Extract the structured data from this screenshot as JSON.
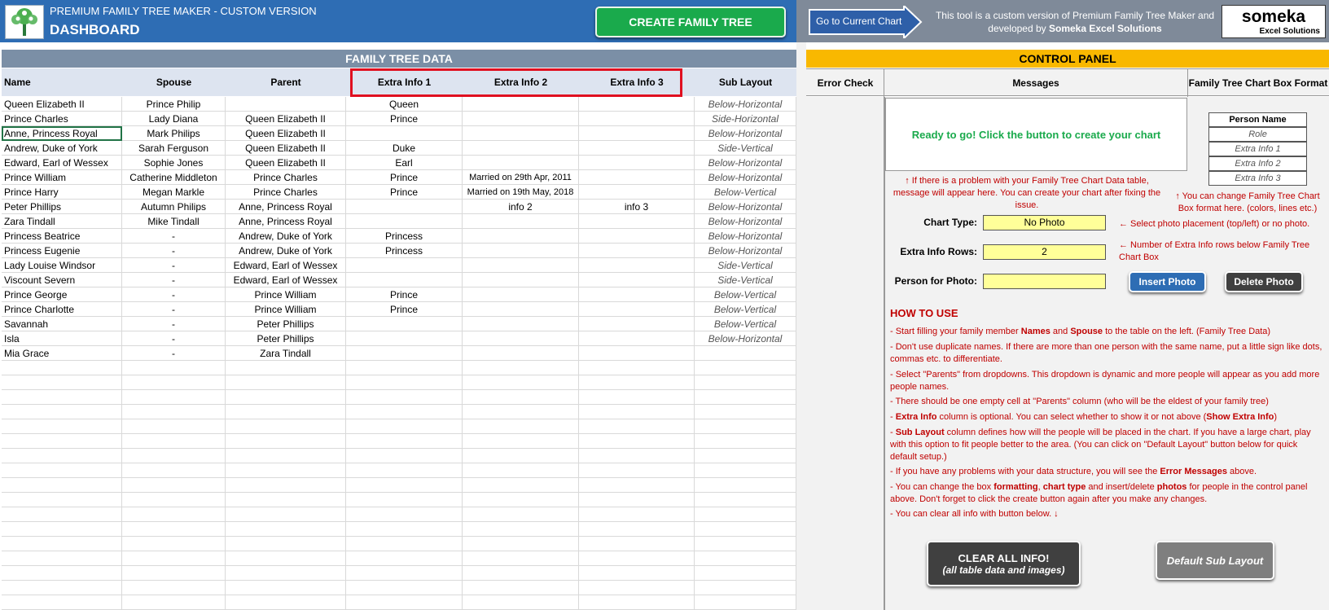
{
  "header": {
    "subtitle": "PREMIUM FAMILY TREE MAKER - CUSTOM VERSION",
    "title": "DASHBOARD",
    "create_button": "CREATE FAMILY TREE",
    "goto_button": "Go to Current Chart",
    "tool_text_1": "This tool is a custom version of Premium Family Tree Maker and",
    "tool_text_2a": "developed by ",
    "tool_text_2b": "Someka Excel Solutions",
    "brand_name": "someka",
    "brand_sub": "Excel Solutions"
  },
  "table": {
    "title": "FAMILY TREE DATA",
    "columns": [
      "Name",
      "Spouse",
      "Parent",
      "Extra Info 1",
      "Extra Info 2",
      "Extra Info 3",
      "Sub Layout"
    ],
    "rows": [
      [
        "Queen Elizabeth II",
        "Prince Philip",
        "",
        "Queen",
        "",
        "",
        "Below-Horizontal"
      ],
      [
        "Prince Charles",
        "Lady Diana",
        "Queen Elizabeth II",
        "Prince",
        "",
        "",
        "Side-Horizontal"
      ],
      [
        "Anne, Princess Royal",
        "Mark Philips",
        "Queen Elizabeth II",
        "",
        "",
        "",
        "Below-Horizontal"
      ],
      [
        "Andrew, Duke of York",
        "Sarah Ferguson",
        "Queen Elizabeth II",
        "Duke",
        "",
        "",
        "Side-Vertical"
      ],
      [
        "Edward, Earl of Wessex",
        "Sophie Jones",
        "Queen Elizabeth II",
        "Earl",
        "",
        "",
        "Below-Horizontal"
      ],
      [
        "Prince William",
        "Catherine Middleton",
        "Prince Charles",
        "Prince",
        "Married on 29th Apr, 2011",
        "",
        "Below-Horizontal"
      ],
      [
        "Prince Harry",
        "Megan Markle",
        "Prince Charles",
        "Prince",
        "Married on 19th May, 2018",
        "",
        "Below-Vertical"
      ],
      [
        "Peter Phillips",
        "Autumn Philips",
        "Anne, Princess Royal",
        "",
        "info 2",
        "info 3",
        "Below-Horizontal"
      ],
      [
        "Zara Tindall",
        "Mike Tindall",
        "Anne, Princess Royal",
        "",
        "",
        "",
        "Below-Horizontal"
      ],
      [
        "Princess Beatrice",
        "-",
        "Andrew, Duke of York",
        "Princess",
        "",
        "",
        "Below-Horizontal"
      ],
      [
        "Princess Eugenie",
        "-",
        "Andrew, Duke of York",
        "Princess",
        "",
        "",
        "Below-Horizontal"
      ],
      [
        "Lady Louise Windsor",
        "-",
        "Edward, Earl of Wessex",
        "",
        "",
        "",
        "Side-Vertical"
      ],
      [
        "Viscount Severn",
        "-",
        "Edward, Earl of Wessex",
        "",
        "",
        "",
        "Side-Vertical"
      ],
      [
        "Prince George",
        "-",
        "Prince William",
        "Prince",
        "",
        "",
        "Below-Vertical"
      ],
      [
        "Prince Charlotte",
        "-",
        "Prince William",
        "Prince",
        "",
        "",
        "Below-Vertical"
      ],
      [
        "Savannah",
        "-",
        "Peter Phillips",
        "",
        "",
        "",
        "Below-Vertical"
      ],
      [
        "Isla",
        "-",
        "Peter Phillips",
        "",
        "",
        "",
        "Below-Horizontal"
      ],
      [
        "Mia Grace",
        "-",
        "Zara Tindall",
        "",
        "",
        "",
        ""
      ]
    ],
    "empty_rows": 17
  },
  "control": {
    "title": "CONTROL PANEL",
    "col_error": "Error Check",
    "col_messages": "Messages",
    "col_format": "Family Tree Chart Box Format",
    "message": "Ready to go! Click the button to create your chart",
    "msg_note": "↑  If there is a problem with your Family Tree Chart Data table, message will appear here. You can create your chart after fixing the issue.",
    "format_box": [
      "Person Name",
      "Role",
      "Extra Info 1",
      "Extra Info 2",
      "Extra Info 3"
    ],
    "format_note": "↑ You can change Family Tree Chart Box format here. (colors, lines etc.)",
    "chart_type_label": "Chart Type:",
    "chart_type_value": "No Photo",
    "chart_type_note": "←  Select photo placement (top/left) or no photo.",
    "extra_rows_label": "Extra Info Rows:",
    "extra_rows_value": "2",
    "extra_rows_note": "←  Number of Extra Info rows below Family Tree Chart Box",
    "photo_label": "Person for Photo:",
    "photo_value": "",
    "insert_photo": "Insert Photo",
    "delete_photo": "Delete Photo",
    "howto_title": "HOW TO USE",
    "howto": [
      "- Start filling your family member Names and Spouse to the table on the left. (Family Tree Data)",
      "- Don't use duplicate names. If there are more than one person with the same name, put a little sign like dots, commas etc. to differentiate.",
      "- Select \"Parents\" from dropdowns. This dropdown is dynamic and more people will appear as you add more people names.",
      "- There should be one empty cell at \"Parents\" column (who will be the eldest of your family tree)",
      "- Extra Info column is optional. You can select whether to show it or not above (Show Extra Info)",
      "- Sub Layout column defines how will the people will be placed in the chart. If you have a large chart, play with this option to fit people better to the area. (You can click on \"Default Layout\" button below for quick default setup.)",
      "- If you have any problems with your data structure, you will see the Error Messages above.",
      "- You can change the box formatting, chart type and insert/delete photos for people  in the control panel above. Don't forget to click the create button again after you make any changes.",
      "- You can clear all info with button below. ↓"
    ],
    "clear_button_1": "CLEAR ALL INFO!",
    "clear_button_2": "(all table data and images)",
    "default_layout_button": "Default Sub Layout"
  },
  "colors": {
    "header_blue": "#2e6db4",
    "create_green": "#1aaa4c",
    "panel_yellow": "#f9b800",
    "input_yellow": "#ffff99",
    "note_red": "#c00000"
  }
}
